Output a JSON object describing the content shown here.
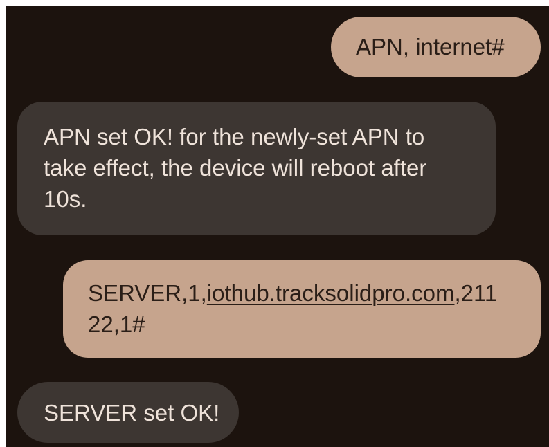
{
  "messages": [
    {
      "direction": "outgoing",
      "lines": [
        "APN, internet#"
      ]
    },
    {
      "direction": "incoming",
      "lines": [
        "APN set OK! for the newly-set APN to",
        "take effect, the device will reboot after",
        "10s."
      ]
    },
    {
      "direction": "outgoing",
      "prefix": "SERVER,1,",
      "link": "iothub.tracksolidpro.com",
      "suffix": ",211",
      "line2": "22,1#"
    },
    {
      "direction": "incoming",
      "lines": [
        "SERVER set OK!"
      ]
    }
  ],
  "colors": {
    "background": "#1c130e",
    "outgoing_bubble": "#c6a48d",
    "incoming_bubble": "#3d3632",
    "outgoing_text": "#2a1e17",
    "incoming_text": "#efe3da"
  }
}
